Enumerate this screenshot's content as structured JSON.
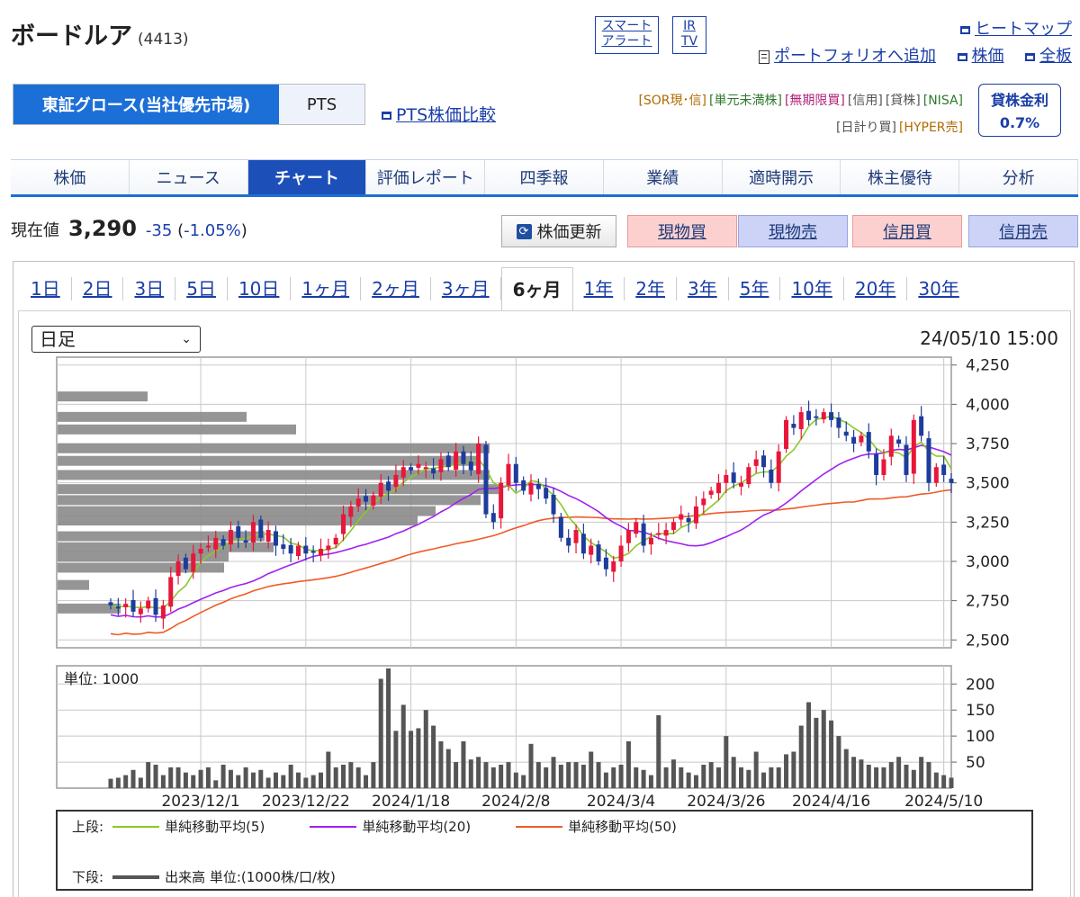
{
  "header": {
    "title": "ボードルア",
    "code": "(4413)",
    "smart_alert": [
      "スマート",
      "アラート"
    ],
    "ir_tv": [
      "IR",
      "TV"
    ],
    "heatmap": "ヒートマップ",
    "portfolio": "ポートフォリオへ追加",
    "stock_price_link": "株価",
    "board_link": "全板"
  },
  "market": {
    "tabs": [
      "東証グロース(当社優先市場)",
      "PTS"
    ],
    "pts_compare": "PTS株価比較"
  },
  "tags": {
    "row1": [
      {
        "text": "[SOR現･信]",
        "color": "#b06a00"
      },
      {
        "text": "[単元未満株]",
        "color": "#2d7a2d"
      },
      {
        "text": "[無期限買]",
        "color": "#b0207a"
      },
      {
        "text": "[信用]",
        "color": "#555555"
      },
      {
        "text": "[貸株]",
        "color": "#555555"
      },
      {
        "text": "[NISA]",
        "color": "#2d7a2d"
      }
    ],
    "row2": [
      {
        "text": "[日計り買]",
        "color": "#555555"
      },
      {
        "text": "[HYPER売]",
        "color": "#b06a00"
      }
    ],
    "lending_label": "貸株金利",
    "lending_rate": "0.7%"
  },
  "nav": {
    "tabs": [
      "株価",
      "ニュース",
      "チャート",
      "評価レポート",
      "四季報",
      "業績",
      "適時開示",
      "株主優待",
      "分析"
    ],
    "active": "チャート"
  },
  "price": {
    "label": "現在値",
    "value": "3,290",
    "change": "-35",
    "change_pct": "(-1.05%)",
    "refresh": "株価更新"
  },
  "trade_buttons": [
    {
      "label": "現物買",
      "bg": "#fdd0d0",
      "border": "#e89a9a"
    },
    {
      "label": "現物売",
      "bg": "#cdd3f7",
      "border": "#9aa4e0"
    },
    {
      "label": "信用買",
      "bg": "#fdd0d0",
      "border": "#e89a9a"
    },
    {
      "label": "信用売",
      "bg": "#cdd3f7",
      "border": "#9aa4e0"
    }
  ],
  "periods": [
    "1日",
    "2日",
    "3日",
    "5日",
    "10日",
    "1ヶ月",
    "2ヶ月",
    "3ヶ月",
    "6ヶ月",
    "1年",
    "2年",
    "3年",
    "5年",
    "10年",
    "20年",
    "30年"
  ],
  "active_period": "6ヶ月",
  "chart_controls": {
    "interval_select": "日足",
    "datetime": "24/05/10 15:00"
  },
  "chart_data": {
    "type": "candlestick",
    "price_ticks": [
      2500,
      2750,
      3000,
      3250,
      3500,
      3750,
      4000,
      4250
    ],
    "price_tick_labels": [
      "2,500",
      "2,750",
      "3,000",
      "3,250",
      "3,500",
      "3,750",
      "4,000",
      "4,250"
    ],
    "ylim": [
      2450,
      4300
    ],
    "x_labels": [
      "2023/12/1",
      "2023/12/22",
      "2024/1/18",
      "2024/2/8",
      "2024/3/4",
      "2024/3/26",
      "2024/4/16",
      "2024/5/10"
    ],
    "x_label_index": [
      12,
      26,
      40,
      54,
      68,
      82,
      96,
      111
    ],
    "n_days": 113,
    "close_series": [
      2720,
      2700,
      2730,
      2680,
      2700,
      2750,
      2660,
      2720,
      2900,
      3000,
      2950,
      3050,
      3080,
      3100,
      3150,
      3100,
      3200,
      3150,
      3120,
      3250,
      3150,
      3200,
      3100,
      3080,
      3050,
      3100,
      3050,
      3060,
      3080,
      3100,
      3150,
      3300,
      3350,
      3400,
      3380,
      3420,
      3500,
      3450,
      3550,
      3600,
      3580,
      3620,
      3600,
      3560,
      3650,
      3600,
      3700,
      3620,
      3580,
      3750,
      3300,
      3250,
      3500,
      3620,
      3500,
      3450,
      3500,
      3460,
      3400,
      3300,
      3150,
      3100,
      3200,
      3050,
      3100,
      3000,
      2950,
      3000,
      3100,
      3200,
      3250,
      3100,
      3150,
      3180,
      3200,
      3250,
      3300,
      3250,
      3350,
      3400,
      3450,
      3500,
      3550,
      3500,
      3500,
      3600,
      3650,
      3600,
      3500,
      3700,
      3900,
      3850,
      3950,
      3900,
      3920,
      3950,
      3900,
      3850,
      3800,
      3750,
      3800,
      3700,
      3550,
      3650,
      3800,
      3750,
      3550,
      3900,
      3800,
      3500,
      3600,
      3550,
      3500
    ],
    "volume_ticks": [
      50,
      100,
      150,
      200
    ],
    "volume_ylim": [
      0,
      235
    ],
    "volume_unit": "単位: 1000",
    "volume": [
      18,
      20,
      25,
      35,
      20,
      50,
      45,
      25,
      40,
      40,
      30,
      25,
      35,
      40,
      15,
      45,
      35,
      25,
      40,
      30,
      35,
      20,
      30,
      25,
      45,
      30,
      20,
      25,
      30,
      70,
      40,
      45,
      50,
      40,
      25,
      50,
      210,
      230,
      110,
      160,
      110,
      115,
      150,
      120,
      90,
      75,
      50,
      90,
      55,
      60,
      50,
      40,
      45,
      50,
      30,
      25,
      85,
      50,
      40,
      60,
      45,
      50,
      50,
      45,
      70,
      50,
      30,
      40,
      45,
      90,
      40,
      35,
      25,
      140,
      40,
      55,
      40,
      30,
      25,
      45,
      50,
      40,
      100,
      60,
      40,
      35,
      70,
      30,
      40,
      40,
      65,
      70,
      120,
      165,
      135,
      150,
      130,
      100,
      75,
      60,
      55,
      45,
      40,
      40,
      50,
      60,
      45,
      35,
      60,
      50,
      30,
      25,
      20
    ],
    "volume_profile": [
      {
        "price": 3460,
        "len": 490
      },
      {
        "price": 3550,
        "len": 480
      },
      {
        "price": 3390,
        "len": 470
      },
      {
        "price": 3640,
        "len": 470
      },
      {
        "price": 3320,
        "len": 420
      },
      {
        "price": 3260,
        "len": 400
      },
      {
        "price": 3720,
        "len": 480
      },
      {
        "price": 3160,
        "len": 230
      },
      {
        "price": 3090,
        "len": 240
      },
      {
        "price": 3030,
        "len": 190
      },
      {
        "price": 2960,
        "len": 185
      },
      {
        "price": 3840,
        "len": 265
      },
      {
        "price": 3920,
        "len": 210
      },
      {
        "price": 4050,
        "len": 100
      },
      {
        "price": 2850,
        "len": 35
      },
      {
        "price": 2700,
        "len": 70
      }
    ],
    "legend": {
      "upper_label": "上段:",
      "lower_label": "下段:",
      "ma5": {
        "name": "単純移動平均(5)",
        "color": "#8ac926"
      },
      "ma20": {
        "name": "単純移動平均(20)",
        "color": "#a020f0"
      },
      "ma50": {
        "name": "単純移動平均(50)",
        "color": "#f05a28"
      },
      "volume": {
        "name": "出来高 単位:(1000株/口/枚)",
        "color": "#555555"
      }
    },
    "colors": {
      "up": "#e8163a",
      "down": "#1d3c9c",
      "profile": "#8a8a8a",
      "volume": "#555555"
    }
  }
}
